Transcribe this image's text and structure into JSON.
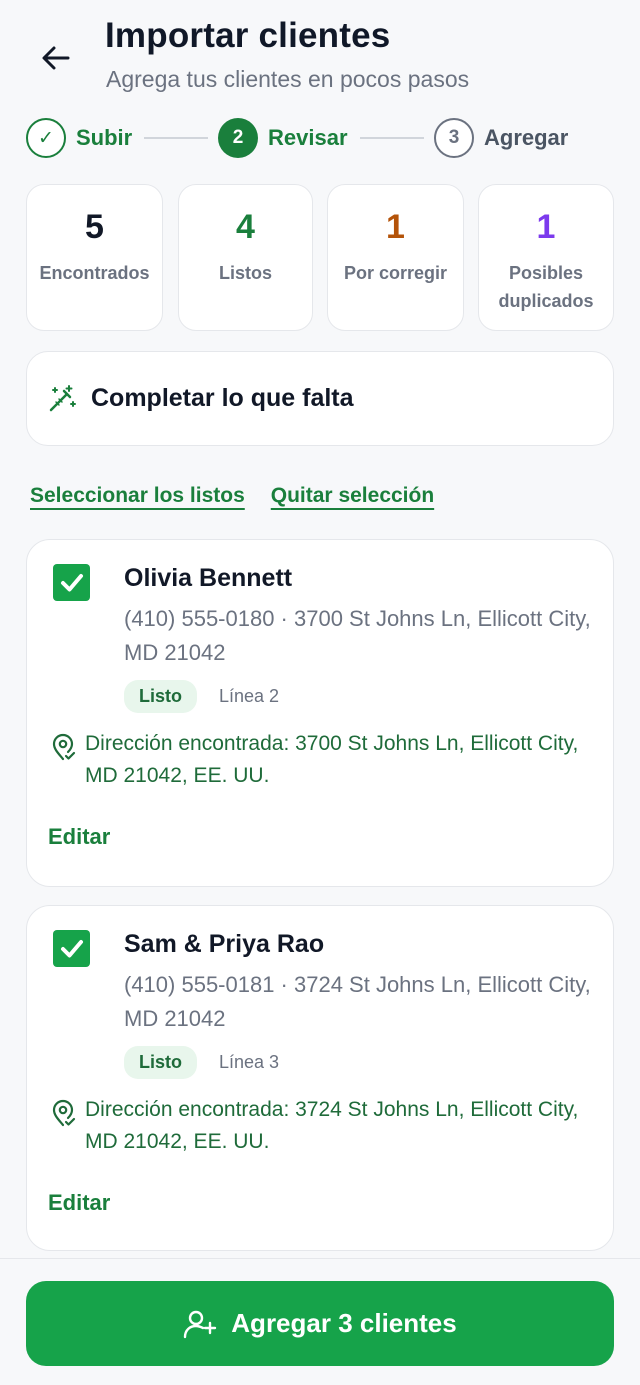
{
  "header": {
    "title": "Importar clientes",
    "subtitle": "Agrega tus clientes en pocos pasos",
    "back_icon": "arrow-left-icon"
  },
  "stepper": {
    "steps": [
      {
        "marker": "✓",
        "label": "Subir",
        "state": "done"
      },
      {
        "marker": "2",
        "label": "Revisar",
        "state": "active"
      },
      {
        "marker": "3",
        "label": "Agregar",
        "state": "todo"
      }
    ]
  },
  "stats": [
    {
      "value": "5",
      "label": "Encontrados",
      "color": "#111827"
    },
    {
      "value": "4",
      "label": "Listos",
      "color": "#1a7f3c"
    },
    {
      "value": "1",
      "label": "Por corregir",
      "color": "#b45309"
    },
    {
      "value": "1",
      "label": "Posibles duplicados",
      "color": "#7c3aed"
    }
  ],
  "fill_button": {
    "label": "Completar lo que falta",
    "icon": "magic-wand-icon"
  },
  "links": {
    "select_ready": "Seleccionar los listos",
    "clear_selection": "Quitar selección"
  },
  "clients": [
    {
      "checked": true,
      "name": "Olivia Bennett",
      "info": "(410) 555-0180 · 3700 St Johns Ln, Ellicott City, MD 21042",
      "status": "Listo",
      "line": "Línea 2",
      "found": "Dirección encontrada: 3700 St Johns Ln, Ellicott City, MD 21042, EE. UU.",
      "edit": "Editar"
    },
    {
      "checked": true,
      "name": "Sam & Priya Rao",
      "info": "(410) 555-0181 · 3724 St Johns Ln, Ellicott City, MD 21042",
      "status": "Listo",
      "line": "Línea 3",
      "found": "Dirección encontrada: 3724 St Johns Ln, Ellicott City, MD 21042, EE. UU.",
      "edit": "Editar"
    }
  ],
  "primary_action": {
    "label": "Agregar 3 clientes",
    "icon": "user-plus-icon"
  },
  "colors": {
    "brand_green": "#16a34a",
    "dark_green": "#1a7f3c",
    "warning": "#b45309",
    "purple": "#7c3aed"
  }
}
